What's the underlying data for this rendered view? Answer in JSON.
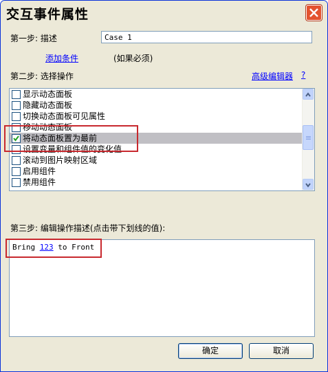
{
  "window": {
    "title": "交互事件属性"
  },
  "step1": {
    "label": "第一步: 描述",
    "value": "Case 1",
    "add_condition": "添加条件",
    "if_needed": "(如果必须)"
  },
  "step2": {
    "label": "第二步: 选择操作",
    "advanced_editor": "高级编辑器",
    "help": "?",
    "actions": [
      {
        "label": "显示动态面板",
        "checked": false
      },
      {
        "label": "隐藏动态面板",
        "checked": false
      },
      {
        "label": "切换动态面板可见属性",
        "checked": false
      },
      {
        "label": "移动动态面板",
        "checked": false
      },
      {
        "label": "将动态面板置为最前",
        "checked": true,
        "selected": true
      },
      {
        "label": "设置变量和组件值的变化值",
        "checked": false
      },
      {
        "label": "滚动到图片映射区域",
        "checked": false
      },
      {
        "label": "启用组件",
        "checked": false
      },
      {
        "label": "禁用组件",
        "checked": false
      }
    ]
  },
  "step3": {
    "label": "第三步: 编辑操作描述(点击带下划线的值):",
    "description": {
      "prefix": "Bring ",
      "param": "123",
      "suffix": " to Front"
    }
  },
  "buttons": {
    "ok": "确定",
    "cancel": "取消"
  },
  "colors": {
    "title_bar": "#ece9d8",
    "link": "#0000ff",
    "highlight_box": "#c8282d",
    "selected_row": "#c0bfc4"
  }
}
